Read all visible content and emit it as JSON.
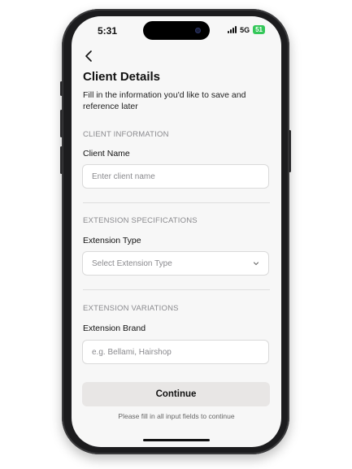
{
  "status_bar": {
    "time": "5:31",
    "network": "5G",
    "battery": "51"
  },
  "header": {
    "back_icon": "chevron-left-icon",
    "title": "Client Details",
    "subtitle": "Fill in the information you'd like to save and reference later"
  },
  "sections": {
    "client_info": {
      "heading": "CLIENT INFORMATION",
      "label": "Client Name",
      "placeholder": "Enter client name",
      "value": ""
    },
    "extension_specs": {
      "heading": "EXTENSION SPECIFICATIONS",
      "label": "Extension Type",
      "selected": "Select Extension Type",
      "icon": "chevron-down-icon"
    },
    "extension_variations": {
      "heading": "EXTENSION VARIATIONS",
      "label": "Extension Brand",
      "placeholder": "e.g. Bellami, Hairshop",
      "value": ""
    }
  },
  "footer": {
    "continue_label": "Continue",
    "hint": "Please fill in all input fields to continue"
  },
  "colors": {
    "background": "#f7f7f7",
    "button": "#e8e6e5",
    "battery": "#34c759",
    "muted_text": "#8a8a8e"
  }
}
